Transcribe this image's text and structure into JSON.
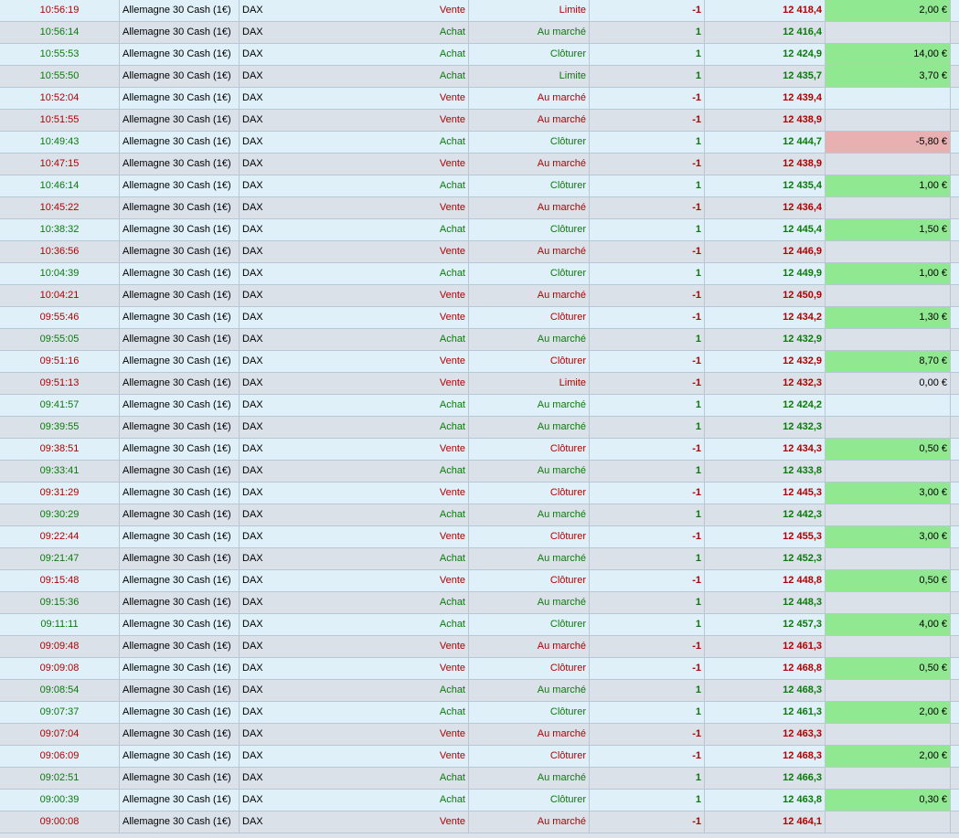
{
  "colors": {
    "buy": "#0a7a0a",
    "sell": "#b00000",
    "profit_bg": "#90e890",
    "loss_bg": "#e8b0b0"
  },
  "rows": [
    {
      "time": "10:56:19",
      "instrument": "Allemagne 30 Cash (1€)",
      "market": "DAX",
      "side": "Vente",
      "type": "Limite",
      "qty": "-1",
      "price": "12 418,4",
      "pnl": "2,00 €",
      "pnl_state": "pos"
    },
    {
      "time": "10:56:14",
      "instrument": "Allemagne 30 Cash (1€)",
      "market": "DAX",
      "side": "Achat",
      "type": "Au marché",
      "qty": "1",
      "price": "12 416,4",
      "pnl": "",
      "pnl_state": "none"
    },
    {
      "time": "10:55:53",
      "instrument": "Allemagne 30 Cash (1€)",
      "market": "DAX",
      "side": "Achat",
      "type": "Clôturer",
      "qty": "1",
      "price": "12 424,9",
      "pnl": "14,00 €",
      "pnl_state": "pos"
    },
    {
      "time": "10:55:50",
      "instrument": "Allemagne 30 Cash (1€)",
      "market": "DAX",
      "side": "Achat",
      "type": "Limite",
      "qty": "1",
      "price": "12 435,7",
      "pnl": "3,70 €",
      "pnl_state": "pos"
    },
    {
      "time": "10:52:04",
      "instrument": "Allemagne 30 Cash (1€)",
      "market": "DAX",
      "side": "Vente",
      "type": "Au marché",
      "qty": "-1",
      "price": "12 439,4",
      "pnl": "",
      "pnl_state": "none"
    },
    {
      "time": "10:51:55",
      "instrument": "Allemagne 30 Cash (1€)",
      "market": "DAX",
      "side": "Vente",
      "type": "Au marché",
      "qty": "-1",
      "price": "12 438,9",
      "pnl": "",
      "pnl_state": "none"
    },
    {
      "time": "10:49:43",
      "instrument": "Allemagne 30 Cash (1€)",
      "market": "DAX",
      "side": "Achat",
      "type": "Clôturer",
      "qty": "1",
      "price": "12 444,7",
      "pnl": "-5,80 €",
      "pnl_state": "neg"
    },
    {
      "time": "10:47:15",
      "instrument": "Allemagne 30 Cash (1€)",
      "market": "DAX",
      "side": "Vente",
      "type": "Au marché",
      "qty": "-1",
      "price": "12 438,9",
      "pnl": "",
      "pnl_state": "none"
    },
    {
      "time": "10:46:14",
      "instrument": "Allemagne 30 Cash (1€)",
      "market": "DAX",
      "side": "Achat",
      "type": "Clôturer",
      "qty": "1",
      "price": "12 435,4",
      "pnl": "1,00 €",
      "pnl_state": "pos"
    },
    {
      "time": "10:45:22",
      "instrument": "Allemagne 30 Cash (1€)",
      "market": "DAX",
      "side": "Vente",
      "type": "Au marché",
      "qty": "-1",
      "price": "12 436,4",
      "pnl": "",
      "pnl_state": "none"
    },
    {
      "time": "10:38:32",
      "instrument": "Allemagne 30 Cash (1€)",
      "market": "DAX",
      "side": "Achat",
      "type": "Clôturer",
      "qty": "1",
      "price": "12 445,4",
      "pnl": "1,50 €",
      "pnl_state": "pos"
    },
    {
      "time": "10:36:56",
      "instrument": "Allemagne 30 Cash (1€)",
      "market": "DAX",
      "side": "Vente",
      "type": "Au marché",
      "qty": "-1",
      "price": "12 446,9",
      "pnl": "",
      "pnl_state": "none"
    },
    {
      "time": "10:04:39",
      "instrument": "Allemagne 30 Cash (1€)",
      "market": "DAX",
      "side": "Achat",
      "type": "Clôturer",
      "qty": "1",
      "price": "12 449,9",
      "pnl": "1,00 €",
      "pnl_state": "pos"
    },
    {
      "time": "10:04:21",
      "instrument": "Allemagne 30 Cash (1€)",
      "market": "DAX",
      "side": "Vente",
      "type": "Au marché",
      "qty": "-1",
      "price": "12 450,9",
      "pnl": "",
      "pnl_state": "none"
    },
    {
      "time": "09:55:46",
      "instrument": "Allemagne 30 Cash (1€)",
      "market": "DAX",
      "side": "Vente",
      "type": "Clôturer",
      "qty": "-1",
      "price": "12 434,2",
      "pnl": "1,30 €",
      "pnl_state": "pos"
    },
    {
      "time": "09:55:05",
      "instrument": "Allemagne 30 Cash (1€)",
      "market": "DAX",
      "side": "Achat",
      "type": "Au marché",
      "qty": "1",
      "price": "12 432,9",
      "pnl": "",
      "pnl_state": "none"
    },
    {
      "time": "09:51:16",
      "instrument": "Allemagne 30 Cash (1€)",
      "market": "DAX",
      "side": "Vente",
      "type": "Clôturer",
      "qty": "-1",
      "price": "12 432,9",
      "pnl": "8,70 €",
      "pnl_state": "pos"
    },
    {
      "time": "09:51:13",
      "instrument": "Allemagne 30 Cash (1€)",
      "market": "DAX",
      "side": "Vente",
      "type": "Limite",
      "qty": "-1",
      "price": "12 432,3",
      "pnl": "0,00 €",
      "pnl_state": "zero"
    },
    {
      "time": "09:41:57",
      "instrument": "Allemagne 30 Cash (1€)",
      "market": "DAX",
      "side": "Achat",
      "type": "Au marché",
      "qty": "1",
      "price": "12 424,2",
      "pnl": "",
      "pnl_state": "none"
    },
    {
      "time": "09:39:55",
      "instrument": "Allemagne 30 Cash (1€)",
      "market": "DAX",
      "side": "Achat",
      "type": "Au marché",
      "qty": "1",
      "price": "12 432,3",
      "pnl": "",
      "pnl_state": "none"
    },
    {
      "time": "09:38:51",
      "instrument": "Allemagne 30 Cash (1€)",
      "market": "DAX",
      "side": "Vente",
      "type": "Clôturer",
      "qty": "-1",
      "price": "12 434,3",
      "pnl": "0,50 €",
      "pnl_state": "pos"
    },
    {
      "time": "09:33:41",
      "instrument": "Allemagne 30 Cash (1€)",
      "market": "DAX",
      "side": "Achat",
      "type": "Au marché",
      "qty": "1",
      "price": "12 433,8",
      "pnl": "",
      "pnl_state": "none"
    },
    {
      "time": "09:31:29",
      "instrument": "Allemagne 30 Cash (1€)",
      "market": "DAX",
      "side": "Vente",
      "type": "Clôturer",
      "qty": "-1",
      "price": "12 445,3",
      "pnl": "3,00 €",
      "pnl_state": "pos"
    },
    {
      "time": "09:30:29",
      "instrument": "Allemagne 30 Cash (1€)",
      "market": "DAX",
      "side": "Achat",
      "type": "Au marché",
      "qty": "1",
      "price": "12 442,3",
      "pnl": "",
      "pnl_state": "none"
    },
    {
      "time": "09:22:44",
      "instrument": "Allemagne 30 Cash (1€)",
      "market": "DAX",
      "side": "Vente",
      "type": "Clôturer",
      "qty": "-1",
      "price": "12 455,3",
      "pnl": "3,00 €",
      "pnl_state": "pos"
    },
    {
      "time": "09:21:47",
      "instrument": "Allemagne 30 Cash (1€)",
      "market": "DAX",
      "side": "Achat",
      "type": "Au marché",
      "qty": "1",
      "price": "12 452,3",
      "pnl": "",
      "pnl_state": "none"
    },
    {
      "time": "09:15:48",
      "instrument": "Allemagne 30 Cash (1€)",
      "market": "DAX",
      "side": "Vente",
      "type": "Clôturer",
      "qty": "-1",
      "price": "12 448,8",
      "pnl": "0,50 €",
      "pnl_state": "pos"
    },
    {
      "time": "09:15:36",
      "instrument": "Allemagne 30 Cash (1€)",
      "market": "DAX",
      "side": "Achat",
      "type": "Au marché",
      "qty": "1",
      "price": "12 448,3",
      "pnl": "",
      "pnl_state": "none"
    },
    {
      "time": "09:11:11",
      "instrument": "Allemagne 30 Cash (1€)",
      "market": "DAX",
      "side": "Achat",
      "type": "Clôturer",
      "qty": "1",
      "price": "12 457,3",
      "pnl": "4,00 €",
      "pnl_state": "pos"
    },
    {
      "time": "09:09:48",
      "instrument": "Allemagne 30 Cash (1€)",
      "market": "DAX",
      "side": "Vente",
      "type": "Au marché",
      "qty": "-1",
      "price": "12 461,3",
      "pnl": "",
      "pnl_state": "none"
    },
    {
      "time": "09:09:08",
      "instrument": "Allemagne 30 Cash (1€)",
      "market": "DAX",
      "side": "Vente",
      "type": "Clôturer",
      "qty": "-1",
      "price": "12 468,8",
      "pnl": "0,50 €",
      "pnl_state": "pos"
    },
    {
      "time": "09:08:54",
      "instrument": "Allemagne 30 Cash (1€)",
      "market": "DAX",
      "side": "Achat",
      "type": "Au marché",
      "qty": "1",
      "price": "12 468,3",
      "pnl": "",
      "pnl_state": "none"
    },
    {
      "time": "09:07:37",
      "instrument": "Allemagne 30 Cash (1€)",
      "market": "DAX",
      "side": "Achat",
      "type": "Clôturer",
      "qty": "1",
      "price": "12 461,3",
      "pnl": "2,00 €",
      "pnl_state": "pos"
    },
    {
      "time": "09:07:04",
      "instrument": "Allemagne 30 Cash (1€)",
      "market": "DAX",
      "side": "Vente",
      "type": "Au marché",
      "qty": "-1",
      "price": "12 463,3",
      "pnl": "",
      "pnl_state": "none"
    },
    {
      "time": "09:06:09",
      "instrument": "Allemagne 30 Cash (1€)",
      "market": "DAX",
      "side": "Vente",
      "type": "Clôturer",
      "qty": "-1",
      "price": "12 468,3",
      "pnl": "2,00 €",
      "pnl_state": "pos"
    },
    {
      "time": "09:02:51",
      "instrument": "Allemagne 30 Cash (1€)",
      "market": "DAX",
      "side": "Achat",
      "type": "Au marché",
      "qty": "1",
      "price": "12 466,3",
      "pnl": "",
      "pnl_state": "none"
    },
    {
      "time": "09:00:39",
      "instrument": "Allemagne 30 Cash (1€)",
      "market": "DAX",
      "side": "Achat",
      "type": "Clôturer",
      "qty": "1",
      "price": "12 463,8",
      "pnl": "0,30 €",
      "pnl_state": "pos"
    },
    {
      "time": "09:00:08",
      "instrument": "Allemagne 30 Cash (1€)",
      "market": "DAX",
      "side": "Vente",
      "type": "Au marché",
      "qty": "-1",
      "price": "12 464,1",
      "pnl": "",
      "pnl_state": "none"
    }
  ]
}
